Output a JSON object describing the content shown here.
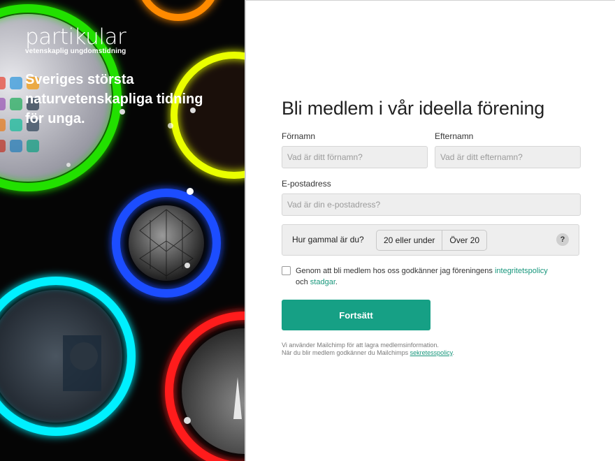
{
  "brand": {
    "name": "partikular",
    "tagline": "vetenskaplig ungdomstidning"
  },
  "hero": {
    "headline": "Sveriges största naturvetenskapliga tidning för unga."
  },
  "form": {
    "title": "Bli medlem i vår ideella förening",
    "first_name": {
      "label": "Förnamn",
      "placeholder": "Vad är ditt förnamn?",
      "value": ""
    },
    "last_name": {
      "label": "Efternamn",
      "placeholder": "Vad är ditt efternamn?",
      "value": ""
    },
    "email": {
      "label": "E-postadress",
      "placeholder": "Vad är din e-postadress?",
      "value": ""
    },
    "age": {
      "label": "Hur gammal är du?",
      "options": [
        "20 eller under",
        "Över 20"
      ],
      "help": "?"
    },
    "consent": {
      "text_before": "Genom att bli medlem hos oss godkänner jag föreningens ",
      "link1": "integritetspolicy",
      "text_middle": " och ",
      "link2": "stadgar",
      "text_after": "."
    },
    "submit_label": "Fortsätt",
    "footnote": {
      "line1": "Vi använder Mailchimp för att lagra medlemsinformation.",
      "line2_before": "När du blir medlem godkänner du Mailchimps ",
      "link": "sekretesspolicy",
      "line2_after": "."
    }
  },
  "colors": {
    "accent": "#16a085",
    "link": "#18977c",
    "input_bg": "#eeeeee"
  }
}
